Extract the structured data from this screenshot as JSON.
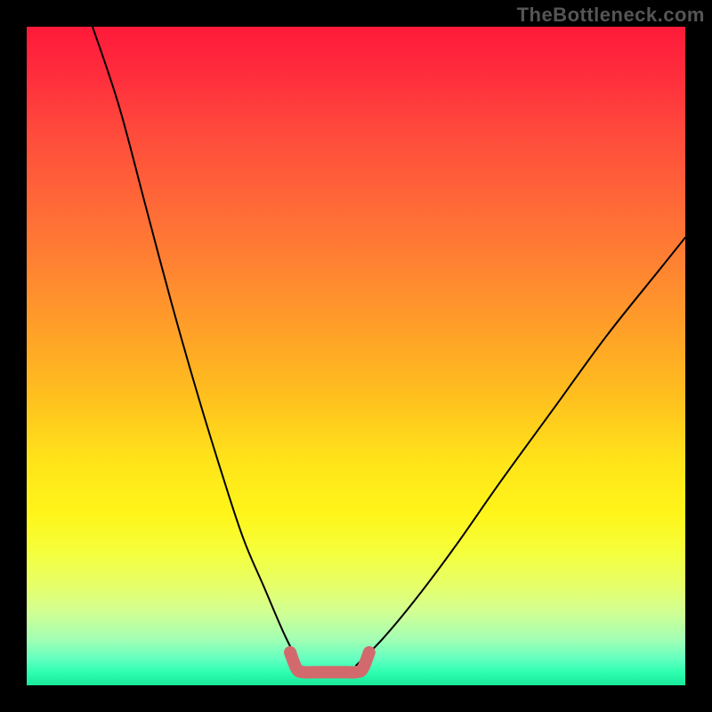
{
  "watermark": "TheBottleneck.com",
  "chart_data": {
    "type": "line",
    "title": "",
    "xlabel": "",
    "ylabel": "",
    "xlim": [
      0,
      100
    ],
    "ylim": [
      0,
      100
    ],
    "series": [
      {
        "name": "left-curve",
        "x": [
          10,
          14,
          18,
          22,
          26,
          30,
          33,
          36,
          39,
          41.5
        ],
        "values": [
          100,
          88,
          73,
          58,
          44,
          31,
          22,
          15,
          8,
          3
        ]
      },
      {
        "name": "right-curve",
        "x": [
          50,
          54,
          59,
          65,
          72,
          80,
          88,
          96,
          100
        ],
        "values": [
          3,
          7,
          13,
          21,
          31,
          42,
          53,
          63,
          68
        ]
      },
      {
        "name": "valley-highlight",
        "x": [
          40,
          41,
          42,
          44,
          48,
          50,
          51,
          52
        ],
        "values": [
          5,
          2.5,
          2,
          2,
          2,
          2,
          2.5,
          5
        ]
      }
    ],
    "colors": {
      "curve": "#000000",
      "highlight": "#d26a6d"
    },
    "grid": false,
    "legend": false
  }
}
